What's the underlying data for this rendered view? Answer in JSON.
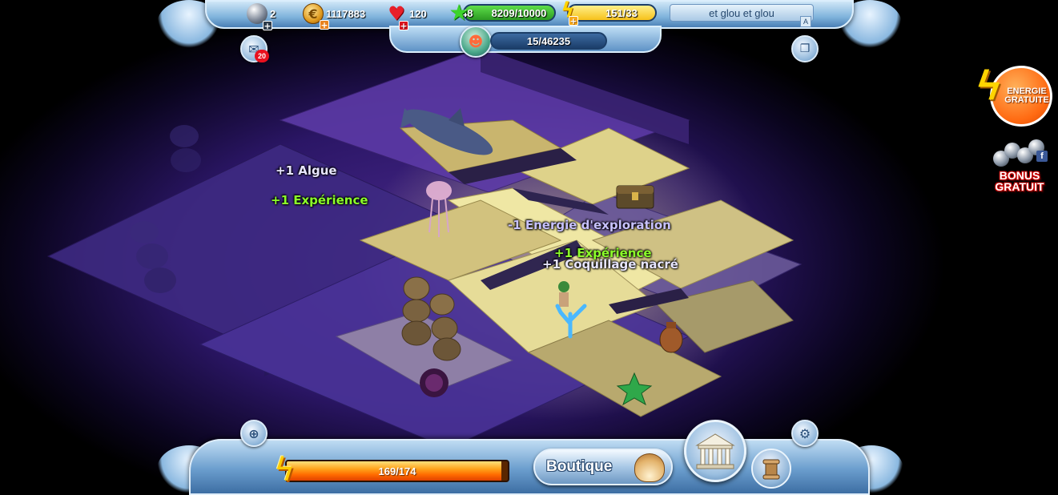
{
  "hud": {
    "pearls": "2",
    "gold": "1117883",
    "health": "120",
    "level": "48",
    "xp": "8209/10000",
    "energy": "151/33",
    "player_name": "et glou et glou",
    "quest_progress": "15/46235",
    "messages_badge": "20",
    "name_box_key": "A"
  },
  "floating_texts": {
    "algue": "+1 Algue",
    "experience_left": "+1 Expérience",
    "energie": "-1 Energie d'exploration",
    "experience_right": "+1 Expérience",
    "coquillage": "+1 Coquillage nacré"
  },
  "promos": {
    "energy_line1": "ENERGIE",
    "energy_line2": "GRATUITE",
    "bonus_line1": "BONUS",
    "bonus_line2": "GRATUIT",
    "facebook": "f"
  },
  "bottom": {
    "exploration_energy": "169/174",
    "exploration_energy_fraction": 0.971,
    "boutique_label": "Boutique"
  },
  "colors": {
    "hud_blue": "#6a9dcd",
    "energy_orange": "#ff6a00",
    "xp_green": "#3cbc2a",
    "text_green": "#8cff2a"
  },
  "icons": [
    "pearl-icon",
    "gold-coin-icon",
    "heart-icon",
    "star-icon",
    "lightning-icon",
    "mermaid-icon",
    "mail-icon",
    "windows-icon",
    "compass-icon",
    "gear-icon",
    "temple-icon",
    "scroll-icon",
    "shell-icon"
  ]
}
